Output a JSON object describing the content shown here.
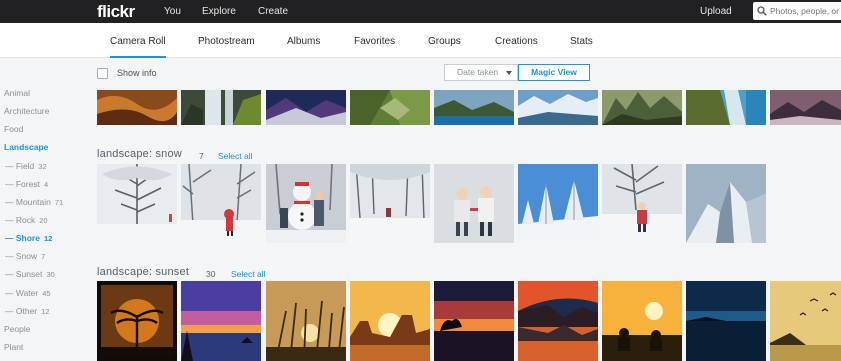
{
  "topbar": {
    "logo": "flickr",
    "nav": [
      "You",
      "Explore",
      "Create"
    ],
    "upload": "Upload",
    "search_placeholder": "Photos, people, or groups"
  },
  "subnav": {
    "tabs": [
      "Camera Roll",
      "Photostream",
      "Albums",
      "Favorites",
      "Groups",
      "Creations",
      "Stats"
    ],
    "active": "Camera Roll"
  },
  "controls": {
    "show_info": "Show info",
    "sort": "Date taken",
    "view": "Magic View"
  },
  "sidebar": {
    "animal": "Animal",
    "architecture": "Architecture",
    "food": "Food",
    "landscape": "Landscape",
    "field": {
      "label": "— Field",
      "count": "32"
    },
    "forest": {
      "label": "— Forest",
      "count": "4"
    },
    "mountain": {
      "label": "— Mountain",
      "count": "71"
    },
    "rock": {
      "label": "— Rock",
      "count": "20"
    },
    "shore": {
      "label": "— Shore",
      "count": "12"
    },
    "snow": {
      "label": "— Snow",
      "count": "7"
    },
    "sunset": {
      "label": "— Sunset",
      "count": "30"
    },
    "water": {
      "label": "— Water",
      "count": "45"
    },
    "other": {
      "label": "— Other",
      "count": "12"
    },
    "people": "People",
    "plant": "Plant"
  },
  "sections": {
    "snow": {
      "title": "landscape: snow",
      "count": "7",
      "select": "Select all"
    },
    "sunset": {
      "title": "landscape: sunset",
      "count": "30",
      "select": "Select all"
    }
  },
  "colors": {
    "accent": "#1c94e0",
    "topbar": "#212124",
    "background": "#f3f5f6"
  }
}
